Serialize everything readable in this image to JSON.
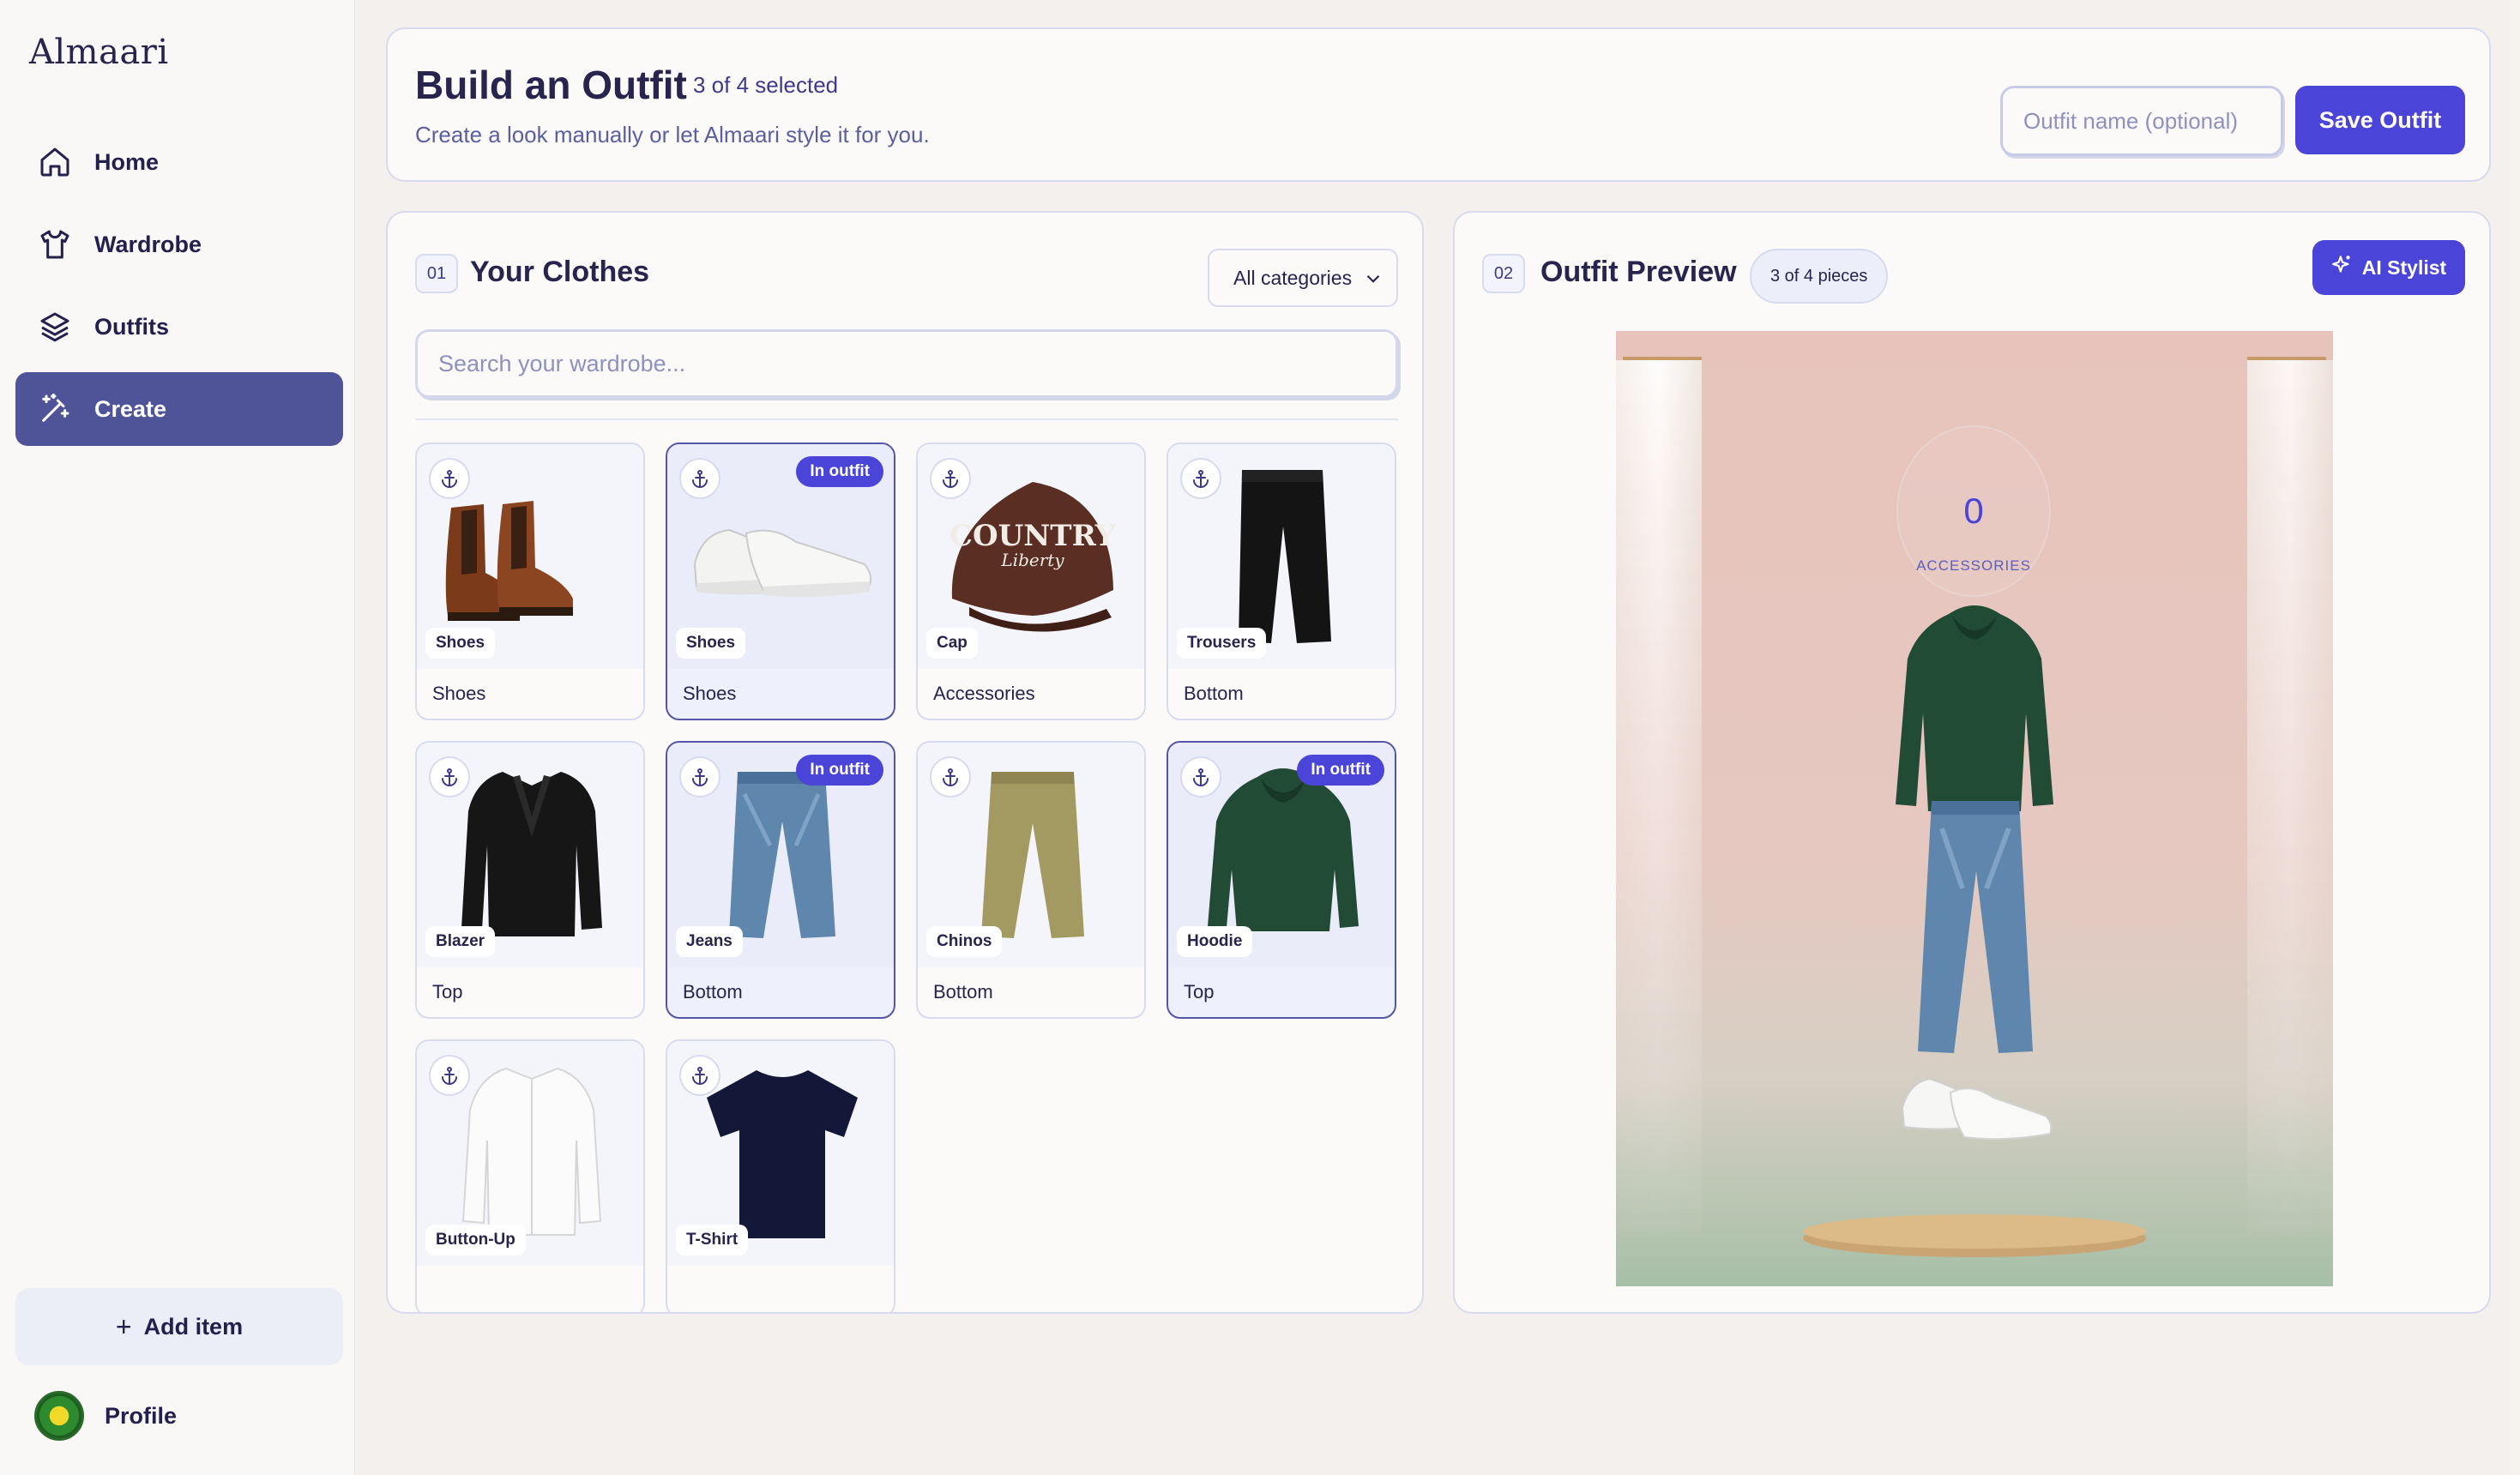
{
  "app": {
    "brand": "Almaari"
  },
  "sidebar": {
    "items": [
      {
        "label": "Home",
        "icon": "home-icon"
      },
      {
        "label": "Wardrobe",
        "icon": "shirt-icon"
      },
      {
        "label": "Outfits",
        "icon": "layers-icon"
      },
      {
        "label": "Create",
        "icon": "magic-wand-icon",
        "active": true
      }
    ],
    "add_item_label": "Add item",
    "profile_label": "Profile"
  },
  "header": {
    "title": "Build an Outfit",
    "selected_count": "3 of 4 selected",
    "subtitle": "Create a look manually or let Almaari style it for you.",
    "outfit_name_placeholder": "Outfit name (optional)",
    "save_label": "Save Outfit"
  },
  "clothes": {
    "section_number": "01",
    "title": "Your Clothes",
    "category_filter": "All categories",
    "search_placeholder": "Search your wardrobe...",
    "badge_label": "In outfit",
    "items": [
      {
        "name": "Shoes",
        "category": "Shoes",
        "in_outfit": false
      },
      {
        "name": "Shoes",
        "category": "Shoes",
        "in_outfit": true
      },
      {
        "name": "Cap",
        "category": "Accessories",
        "in_outfit": false
      },
      {
        "name": "Trousers",
        "category": "Bottom",
        "in_outfit": false
      },
      {
        "name": "Blazer",
        "category": "Top",
        "in_outfit": false
      },
      {
        "name": "Jeans",
        "category": "Bottom",
        "in_outfit": true
      },
      {
        "name": "Chinos",
        "category": "Bottom",
        "in_outfit": false
      },
      {
        "name": "Hoodie",
        "category": "Top",
        "in_outfit": true
      },
      {
        "name": "Button-Up",
        "category": "",
        "in_outfit": false
      },
      {
        "name": "T-Shirt",
        "category": "",
        "in_outfit": false
      }
    ],
    "cap_print": {
      "line1": "COUNTRY",
      "line2": "Liberty"
    }
  },
  "preview": {
    "section_number": "02",
    "title": "Outfit Preview",
    "pieces": "3 of 4 pieces",
    "ai_label": "AI Stylist",
    "accessories_count": "0",
    "accessories_label": "ACCESSORIES"
  },
  "colors": {
    "accent": "#4b44d8",
    "active_nav": "#4f5499",
    "text": "#27244e"
  }
}
